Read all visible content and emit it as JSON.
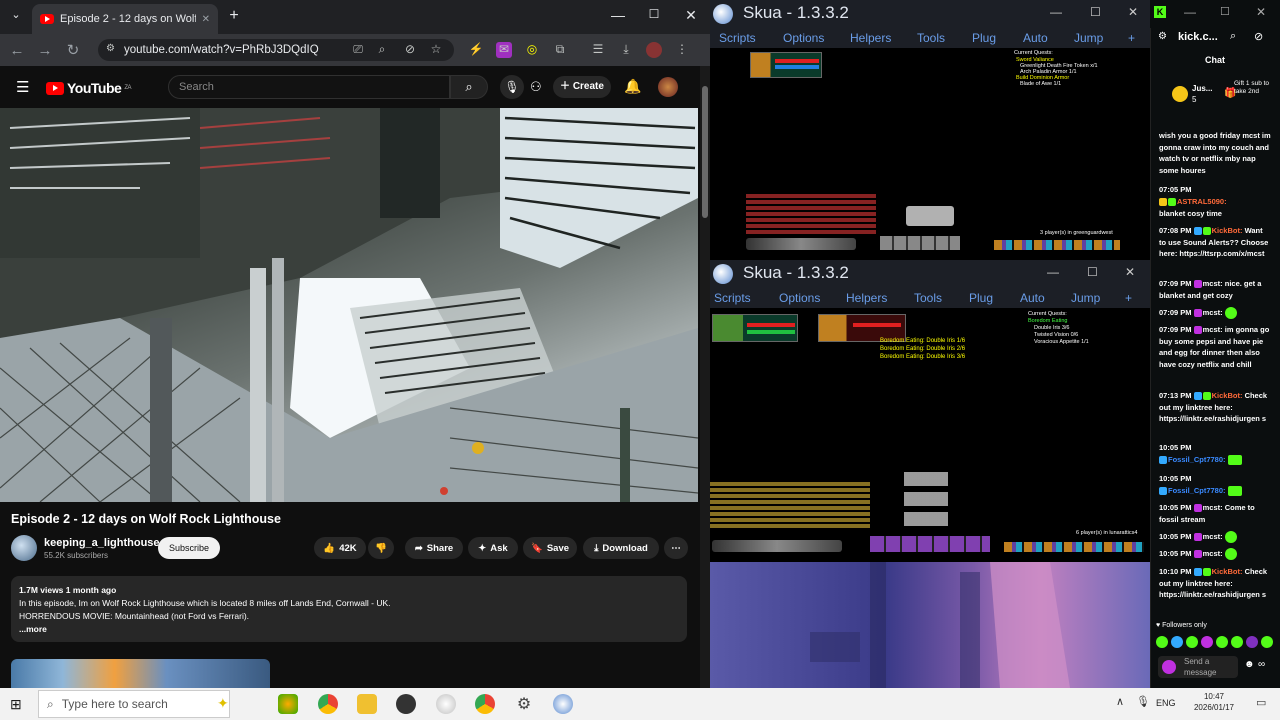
{
  "browser": {
    "tab_title": "Episode 2 - 12 days on Wolf",
    "url": "youtube.com/watch?v=PhRbJ3DQdIQ",
    "window_controls": {
      "minimize": "—",
      "maximize": "☐",
      "close": "✕"
    },
    "new_tab": "+"
  },
  "youtube": {
    "logo_text": "YouTube",
    "country_code": "ZA",
    "search_placeholder": "Search",
    "create_label": "Create",
    "video_title": "Episode 2 - 12 days on Wolf Rock Lighthouse",
    "channel_name": "keeping_a_lighthouse",
    "subscribers": "55.2K subscribers",
    "subscribe_label": "Subscribe",
    "likes": "42K",
    "share_label": "Share",
    "ask_label": "Ask",
    "save_label": "Save",
    "download_label": "Download",
    "views_date": "1.7M views  1 month ago",
    "description_line1": "In this episode, Im on Wolf Rock Lighthouse which is located 8 miles off Lands End, Cornwall - UK.",
    "description_line2": "HORRENDOUS MOVIE: Mountainhead (not Ford vs Ferrari).",
    "more_label": "...more"
  },
  "skua": [
    {
      "title": "Skua - 1.3.3.2",
      "menu": [
        "Scripts",
        "Options",
        "Helpers",
        "Tools",
        "Plug",
        "Auto",
        "Jump",
        "+"
      ],
      "quest_header": "Current Quests:",
      "quests": [
        "Sword Valiance",
        "Greenlight Death Fire Token x/1",
        "Arch Paladin Armor 1/1",
        "Build Dominion Armor",
        "Blade of Awe 1/1"
      ],
      "players": "3 player(s) in greenguardwest"
    },
    {
      "title": "Skua - 1.3.3.2",
      "menu": [
        "Scripts",
        "Options",
        "Helpers",
        "Tools",
        "Plug",
        "Auto",
        "Jump",
        "+"
      ],
      "quest_header": "Current Quests:",
      "quests": [
        "Boredom Eating",
        "Double Iris 3/6",
        "Twisted Vision 0/6",
        "Voracious Appetite 1/1"
      ],
      "yellow_lines": [
        "Boredom Eating: Double Iris 1/6",
        "Boredom Eating: Double Iris 2/6",
        "Boredom Eating: Double Iris 3/6"
      ],
      "players": "6 player(s) in lunarattics4"
    }
  ],
  "kick": {
    "channel": "kick.c...",
    "chat_label": "Chat",
    "gift_user": "Jus...",
    "gift_count": "5",
    "gift_text": "Gift 1 sub to take 2nd",
    "messages": [
      {
        "time": "",
        "user": "",
        "text": "wish you a good friday mcst im gonna craw into my couch and watch tv or netflix mby nap some houres"
      },
      {
        "time": "07:05 PM",
        "user": "ASTRAL5090:",
        "text": "blanket cosy time"
      },
      {
        "time": "07:08 PM",
        "user": "KickBot:",
        "text": "Want to use Sound Alerts?? Choose here: https://ttsrp.com/x/mcst"
      },
      {
        "time": "07:09 PM",
        "user": "mcst:",
        "text": "nice. get a blanket and get cozy"
      },
      {
        "time": "07:09 PM",
        "user": "mcst:",
        "text": ""
      },
      {
        "time": "07:09 PM",
        "user": "mcst:",
        "text": "im gonna go buy some pepsi and have pie and egg for dinner then also have cozy netflix and chill"
      },
      {
        "time": "07:13 PM",
        "user": "KickBot:",
        "text": "Check out my linktree here: https://linktr.ee/rashidjurgen s"
      },
      {
        "time": "10:05 PM",
        "user": "Fossil_Cpt7780:",
        "text": ""
      },
      {
        "time": "10:05 PM",
        "user": "Fossil_Cpt7780:",
        "text": ""
      },
      {
        "time": "10:05 PM",
        "user": "mcst:",
        "text": "Come to fossil stream"
      },
      {
        "time": "10:05 PM",
        "user": "mcst:",
        "text": ""
      },
      {
        "time": "10:05 PM",
        "user": "mcst:",
        "text": ""
      },
      {
        "time": "10:10 PM",
        "user": "KickBot:",
        "text": "Check out my linktree here: https://linktr.ee/rashidjurgen s"
      }
    ],
    "followers_only": "Followers only",
    "send_placeholder": "Send a message"
  },
  "taskbar": {
    "search_placeholder": "Type here to search",
    "language": "ENG",
    "time": "10:47",
    "date": "2026/01/17"
  },
  "colors": {
    "youtube_red": "#ff0000",
    "kick_green": "#53fc18",
    "skua_menu_blue": "#6a9de8",
    "game_yellow": "#ffff00"
  }
}
